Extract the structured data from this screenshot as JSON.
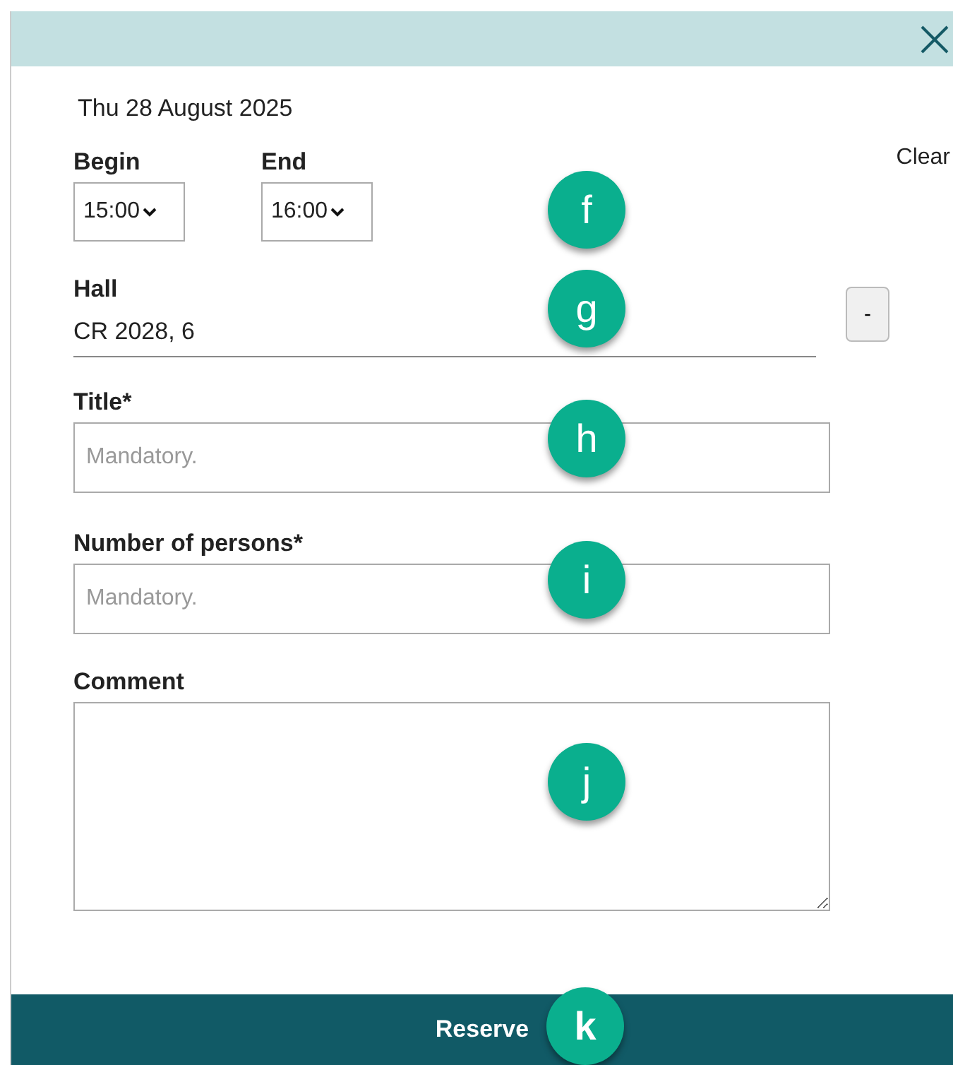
{
  "date": "Thu 28 August 2025",
  "clear": "Clear",
  "times": [
    {
      "label": "Begin",
      "value": "15:00"
    },
    {
      "label": "End",
      "value": "16:00"
    }
  ],
  "times_marker": "f",
  "hall": {
    "label": "Hall",
    "value": "CR 2028, 6",
    "remove": "-",
    "marker": "g"
  },
  "fields": [
    {
      "label": "Title*",
      "placeholder": "Mandatory.",
      "marker": "h"
    },
    {
      "label": "Number of persons*",
      "placeholder": "Mandatory.",
      "marker": "i"
    }
  ],
  "comment": {
    "label": "Comment",
    "marker": "j"
  },
  "reserve": {
    "label": "Reserve",
    "marker": "k"
  }
}
